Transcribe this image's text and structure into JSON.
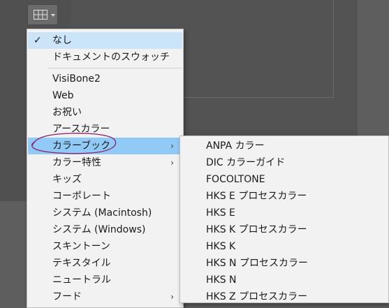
{
  "toolbar": {
    "grid_button_icon": "grid-icon"
  },
  "menu": {
    "items": [
      {
        "label": "なし",
        "checked": true
      },
      {
        "label": "ドキュメントのスウォッチ"
      },
      {
        "label": "VisiBone2"
      },
      {
        "label": "Web"
      },
      {
        "label": "お祝い"
      },
      {
        "label": "アースカラー"
      },
      {
        "label": "カラーブック",
        "submenu": true,
        "active": true
      },
      {
        "label": "カラー特性",
        "submenu": true
      },
      {
        "label": "キッズ"
      },
      {
        "label": "コーポレート"
      },
      {
        "label": "システム (Macintosh)"
      },
      {
        "label": "システム (Windows)"
      },
      {
        "label": "スキントーン"
      },
      {
        "label": "テキスタイル"
      },
      {
        "label": "ニュートラル"
      },
      {
        "label": "フード",
        "submenu": true
      }
    ]
  },
  "submenu": {
    "items": [
      {
        "label": "ANPA カラー"
      },
      {
        "label": "DIC カラーガイド"
      },
      {
        "label": "FOCOLTONE"
      },
      {
        "label": "HKS E プロセスカラー"
      },
      {
        "label": "HKS E"
      },
      {
        "label": "HKS K プロセスカラー"
      },
      {
        "label": "HKS K"
      },
      {
        "label": "HKS N プロセスカラー"
      },
      {
        "label": "HKS N"
      },
      {
        "label": "HKS Z プロセスカラー"
      }
    ]
  },
  "colors": {
    "highlight": "#91c9f7",
    "checked_bg": "#cce4f7",
    "annotation": "#8a1f6b"
  }
}
